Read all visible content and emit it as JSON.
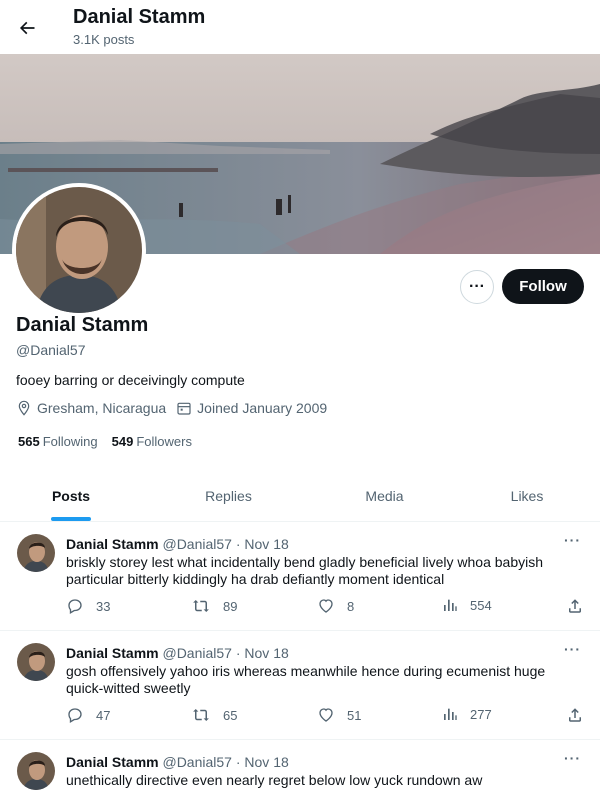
{
  "header": {
    "title": "Danial Stamm",
    "post_count": "3.1K posts"
  },
  "profile": {
    "display_name": "Danial Stamm",
    "handle": "@Danial57",
    "bio": "fooey barring or deceivingly compute",
    "location": "Gresham, Nicaragua",
    "joined": "Joined January 2009",
    "following_count": "565",
    "following_label": "Following",
    "followers_count": "549",
    "followers_label": "Followers",
    "follow_label": "Follow",
    "more_label": "···"
  },
  "tabs": [
    {
      "label": "Posts",
      "active": true
    },
    {
      "label": "Replies",
      "active": false
    },
    {
      "label": "Media",
      "active": false
    },
    {
      "label": "Likes",
      "active": false
    }
  ],
  "tweets": [
    {
      "name": "Danial Stamm",
      "handle": "@Danial57",
      "date": "· Nov 18",
      "text": "briskly storey lest what incidentally bend gladly beneficial lively whoa babyish particular bitterly kiddingly ha drab defiantly moment identical",
      "replies": "33",
      "retweets": "89",
      "likes": "8",
      "views": "554"
    },
    {
      "name": "Danial Stamm",
      "handle": "@Danial57",
      "date": "· Nov 18",
      "text": "gosh offensively yahoo iris whereas meanwhile hence during ecumenist huge quick-witted sweetly",
      "replies": "47",
      "retweets": "65",
      "likes": "51",
      "views": "277"
    },
    {
      "name": "Danial Stamm",
      "handle": "@Danial57",
      "date": "· Nov 18",
      "text": "unethically directive even nearly regret below low yuck rundown aw",
      "replies": "",
      "retweets": "",
      "likes": "",
      "views": ""
    }
  ],
  "tweet_more_label": "···",
  "icons": [
    "back-arrow-icon",
    "location-icon",
    "calendar-icon",
    "reply-icon",
    "retweet-icon",
    "like-icon",
    "views-icon",
    "share-icon"
  ],
  "colors": {
    "accent": "#1d9bf0",
    "follow_button": "#0f1419",
    "secondary_text": "#536471"
  }
}
